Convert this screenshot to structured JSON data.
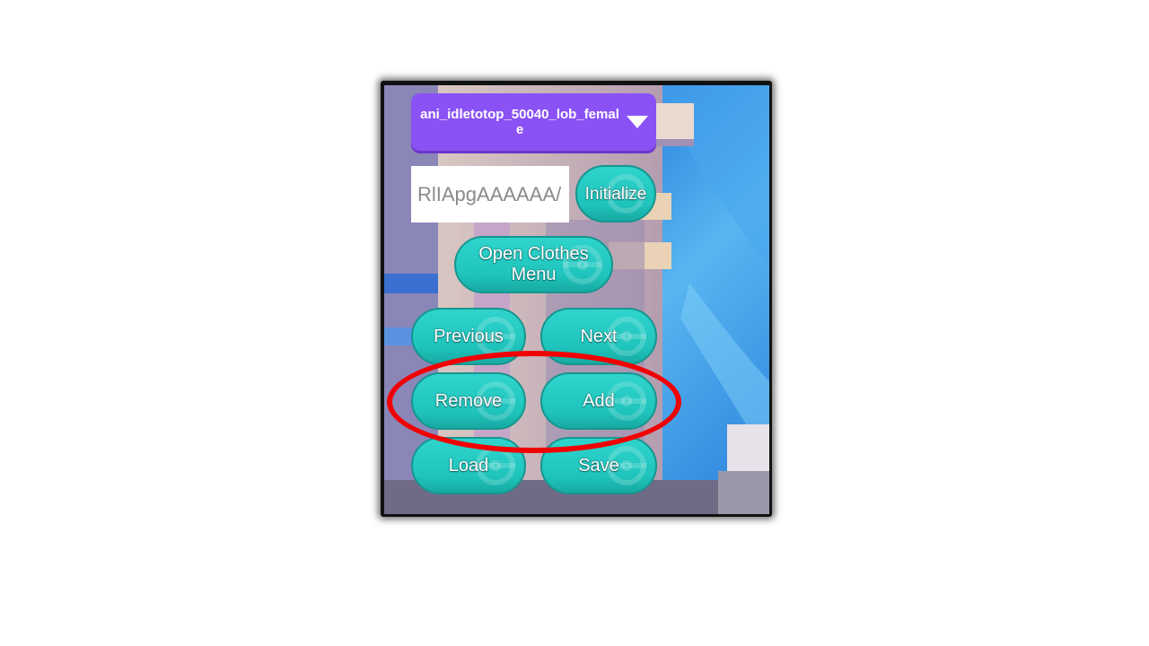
{
  "animation_selector": {
    "selected": "ani_idletotop_50040_lob_female"
  },
  "code_input": {
    "value": "RlIApgAAAAAA/"
  },
  "buttons": {
    "initialize": "Initialize",
    "open_clothes_menu": "Open Clothes Menu",
    "previous": "Previous",
    "next": "Next",
    "remove": "Remove",
    "add": "Add",
    "load": "Load",
    "save": "Save"
  },
  "colors": {
    "button": "#1fc4bc",
    "dropdown": "#8a52f5",
    "highlight": "#f00000"
  }
}
